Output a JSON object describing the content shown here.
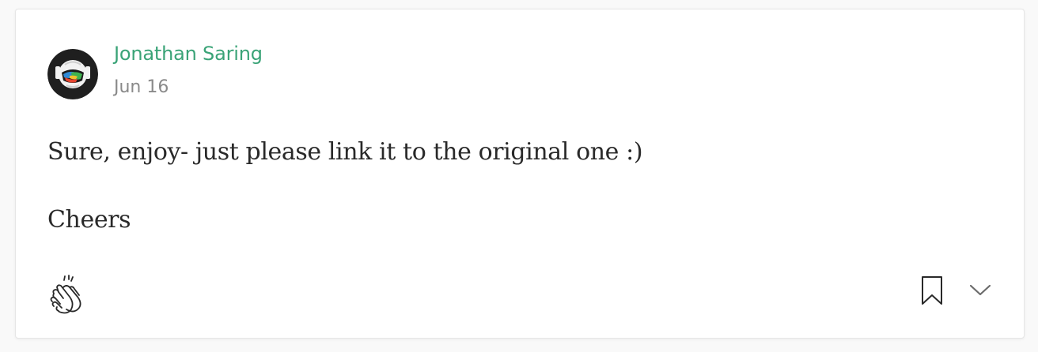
{
  "comment": {
    "author": {
      "name": "Jonathan Saring"
    },
    "date": "Jun 16",
    "paragraphs": [
      "Sure, enjoy- just please link it to the original one :)",
      "Cheers"
    ]
  },
  "actions": {
    "clap_icon": "clap-icon",
    "bookmark_icon": "bookmark-icon",
    "more_icon": "chevron-down-icon"
  },
  "colors": {
    "author_link": "#3aa377",
    "meta_text": "#8a8a8a",
    "body_text": "#292929",
    "icon": "#6b6b6b"
  }
}
